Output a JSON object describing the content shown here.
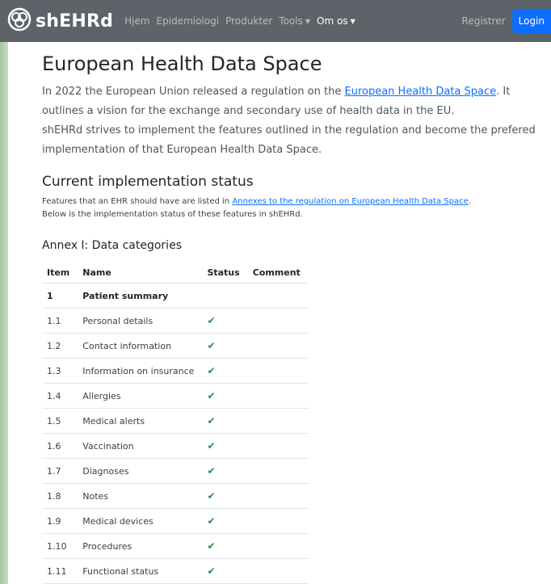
{
  "navbar": {
    "brand": "shEHRd",
    "links": [
      "Hjem",
      "Epidemiologi",
      "Produkter",
      "Tools",
      "Om os"
    ],
    "register": "Registrer",
    "login": "Login"
  },
  "page": {
    "title": "European Health Data Space",
    "intro_1_before": "In 2022 the European Union released a regulation on the ",
    "intro_1_link": "European Health Data Space",
    "intro_1_after": ". It outlines a vision for the exchange and secondary use of health data in the EU.",
    "intro_2": "shEHRd strives to implement the features outlined in the regulation and become the prefered implementation of that European Health Data Space.",
    "status_heading": "Current implementation status",
    "features_before": "Features that an EHR should have are listed in ",
    "features_link": "Annexes to the regulation on European Health Data Space",
    "features_after": ".",
    "features_2": "Below is the implementation status of these features in shEHRd.",
    "annex_heading": "Annex I: Data categories"
  },
  "table": {
    "headers": [
      "Item",
      "Name",
      "Status",
      "Comment"
    ],
    "rows": [
      {
        "item": "1",
        "name": "Patient summary",
        "status": "",
        "group": true
      },
      {
        "item": "1.1",
        "name": "Personal details",
        "status": "✔"
      },
      {
        "item": "1.2",
        "name": "Contact information",
        "status": "✔"
      },
      {
        "item": "1.3",
        "name": "Information on insurance",
        "status": "✔"
      },
      {
        "item": "1.4",
        "name": "Allergies",
        "status": "✔"
      },
      {
        "item": "1.5",
        "name": "Medical alerts",
        "status": "✔"
      },
      {
        "item": "1.6",
        "name": "Vaccination",
        "status": "✔"
      },
      {
        "item": "1.7",
        "name": "Diagnoses",
        "status": "✔"
      },
      {
        "item": "1.8",
        "name": "Notes",
        "status": "✔"
      },
      {
        "item": "1.9",
        "name": "Medical devices",
        "status": "✔"
      },
      {
        "item": "1.10",
        "name": "Procedures",
        "status": "✔"
      },
      {
        "item": "1.11",
        "name": "Functional status",
        "status": "✔"
      }
    ]
  },
  "colors": {
    "navbar": "#5d6368",
    "link": "#0d6efd",
    "check": "#2e8b3a"
  }
}
